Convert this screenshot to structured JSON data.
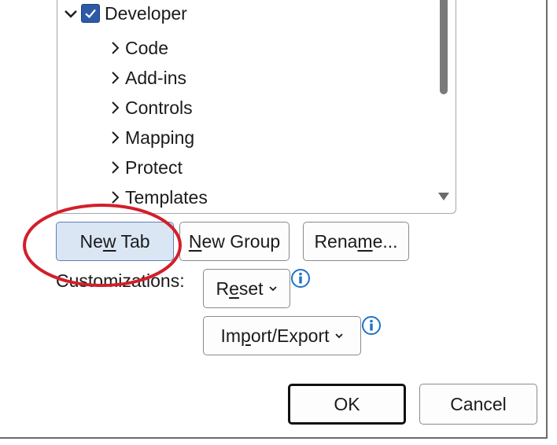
{
  "tree": {
    "root": {
      "label": "Developer",
      "checked": true,
      "expanded": true
    },
    "children": [
      "Code",
      "Add-ins",
      "Controls",
      "Mapping",
      "Protect",
      "Templates"
    ]
  },
  "buttons": {
    "new_tab": {
      "pre": "Ne",
      "ul": "w",
      "post": " Tab"
    },
    "new_group": {
      "pre": "",
      "ul": "N",
      "post": "ew Group"
    },
    "rename": {
      "pre": "Rena",
      "ul": "m",
      "post": "e..."
    },
    "reset": {
      "pre": "R",
      "ul": "e",
      "post": "set"
    },
    "import_export": {
      "pre": "Im",
      "ul": "p",
      "post": "ort/Export"
    },
    "ok": "OK",
    "cancel": "Cancel"
  },
  "customizations_label": "Customizations:",
  "colors": {
    "checkbox": "#2d5aa7",
    "info_icon": "#1a73c9",
    "annotation": "#d21f2b",
    "selected_button": "#dbe6f5"
  }
}
